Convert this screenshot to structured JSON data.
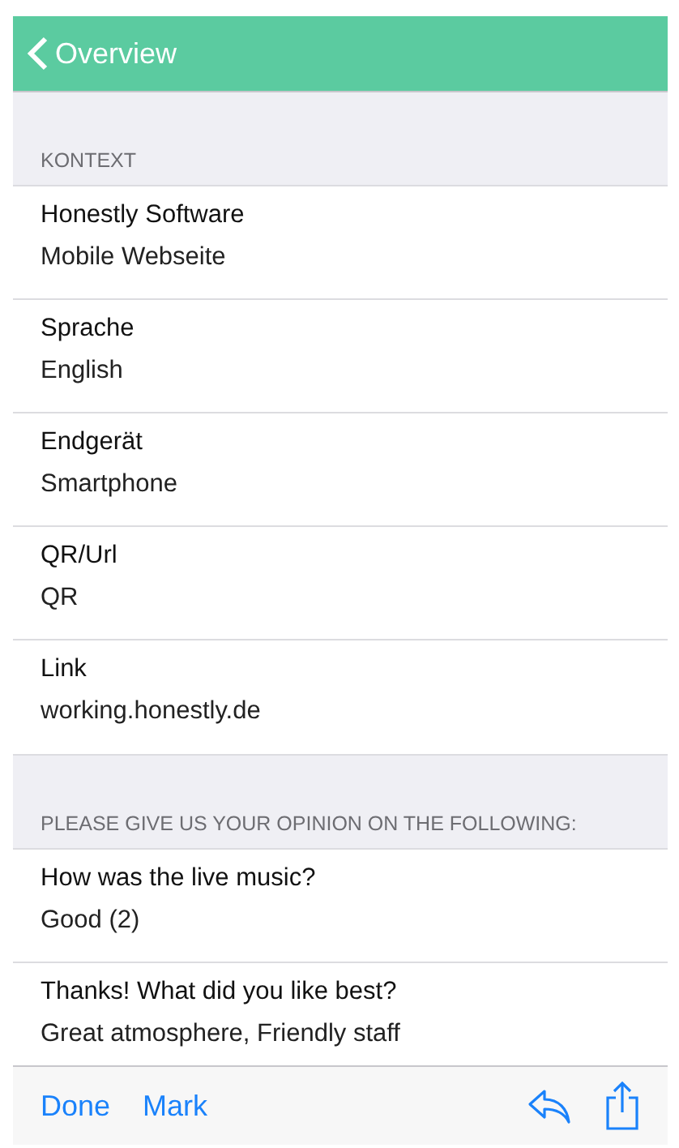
{
  "nav_bar": {
    "back_label": "Overview"
  },
  "sections": [
    {
      "header": "KONTEXT",
      "rows": [
        {
          "label": "Honestly Software",
          "value": "Mobile Webseite"
        },
        {
          "label": "Sprache",
          "value": "English"
        },
        {
          "label": "Endgerät",
          "value": "Smartphone"
        },
        {
          "label": "QR/Url",
          "value": "QR"
        },
        {
          "label": "Link",
          "value": "working.honestly.de"
        }
      ]
    },
    {
      "header": "PLEASE GIVE US YOUR OPINION ON THE FOLLOWING:",
      "rows": [
        {
          "label": "How was the live music?",
          "value": "Good (2)"
        },
        {
          "label": "Thanks! What did you like best?",
          "value": "Great atmosphere, Friendly staff"
        }
      ]
    }
  ],
  "toolbar": {
    "buttons": [
      "Done",
      "Mark"
    ]
  }
}
